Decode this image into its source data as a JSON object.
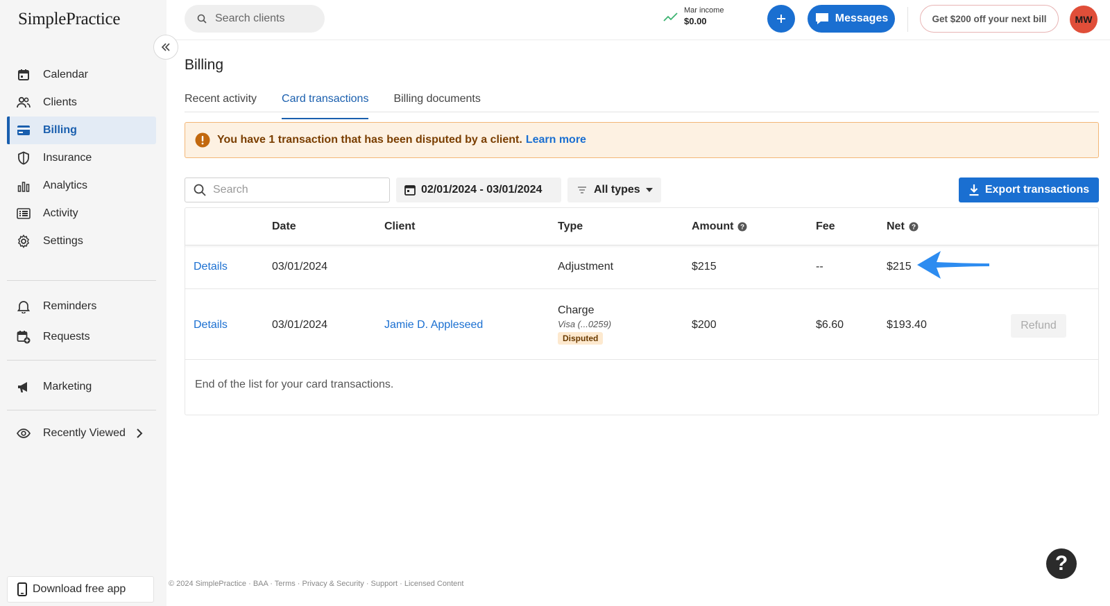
{
  "app": {
    "logo": "SimplePractice"
  },
  "sidebar": {
    "nav": [
      {
        "label": "Calendar",
        "icon": "calendar-icon"
      },
      {
        "label": "Clients",
        "icon": "users-icon"
      },
      {
        "label": "Billing",
        "icon": "credit-card-icon",
        "active": true
      },
      {
        "label": "Insurance",
        "icon": "shield-icon"
      },
      {
        "label": "Analytics",
        "icon": "bar-chart-icon"
      },
      {
        "label": "Activity",
        "icon": "list-icon"
      },
      {
        "label": "Settings",
        "icon": "gear-icon"
      }
    ],
    "secondary": [
      {
        "label": "Reminders",
        "icon": "bell-icon"
      },
      {
        "label": "Requests",
        "icon": "calendar-plus-icon"
      }
    ],
    "marketing": {
      "label": "Marketing",
      "icon": "megaphone-icon"
    },
    "recently_viewed": {
      "label": "Recently Viewed",
      "icon": "eye-icon"
    },
    "download_app": "Download free app"
  },
  "topbar": {
    "search_placeholder": "Search clients",
    "income_label": "Mar income",
    "income_value": "$0.00",
    "messages_label": "Messages",
    "promo_label": "Get $200 off your next bill",
    "avatar_initials": "MW"
  },
  "page": {
    "title": "Billing",
    "tabs": [
      {
        "label": "Recent activity"
      },
      {
        "label": "Card transactions",
        "active": true
      },
      {
        "label": "Billing documents"
      }
    ]
  },
  "alert": {
    "text": "You have 1 transaction that has been disputed by a client.",
    "link": "Learn more"
  },
  "filters": {
    "search_placeholder": "Search",
    "date_range": "02/01/2024 - 03/01/2024",
    "types_label": "All types",
    "export_label": "Export transactions"
  },
  "table": {
    "columns": [
      "Date",
      "Client",
      "Type",
      "Amount",
      "Fee",
      "Net"
    ],
    "rows": [
      {
        "details": "Details",
        "date": "03/01/2024",
        "client": "",
        "type": "Adjustment",
        "amount": "$215",
        "fee": "--",
        "net": "$215"
      },
      {
        "details": "Details",
        "date": "03/01/2024",
        "client": "Jamie D. Appleseed",
        "type": "Charge",
        "type_sub": "Visa (...0259)",
        "badge": "Disputed",
        "amount": "$200",
        "fee": "$6.60",
        "net": "$193.40",
        "action": "Refund"
      }
    ],
    "end_note": "End of the list for your card transactions."
  },
  "footer": "© 2024 SimplePractice · BAA · Terms · Privacy & Security · Support · Licensed Content",
  "help_label": "?",
  "colors": {
    "accent": "#1a6fd1",
    "alert_bg": "#fdf1e2",
    "alert_border": "#f3b676",
    "avatar": "#e04e39"
  }
}
